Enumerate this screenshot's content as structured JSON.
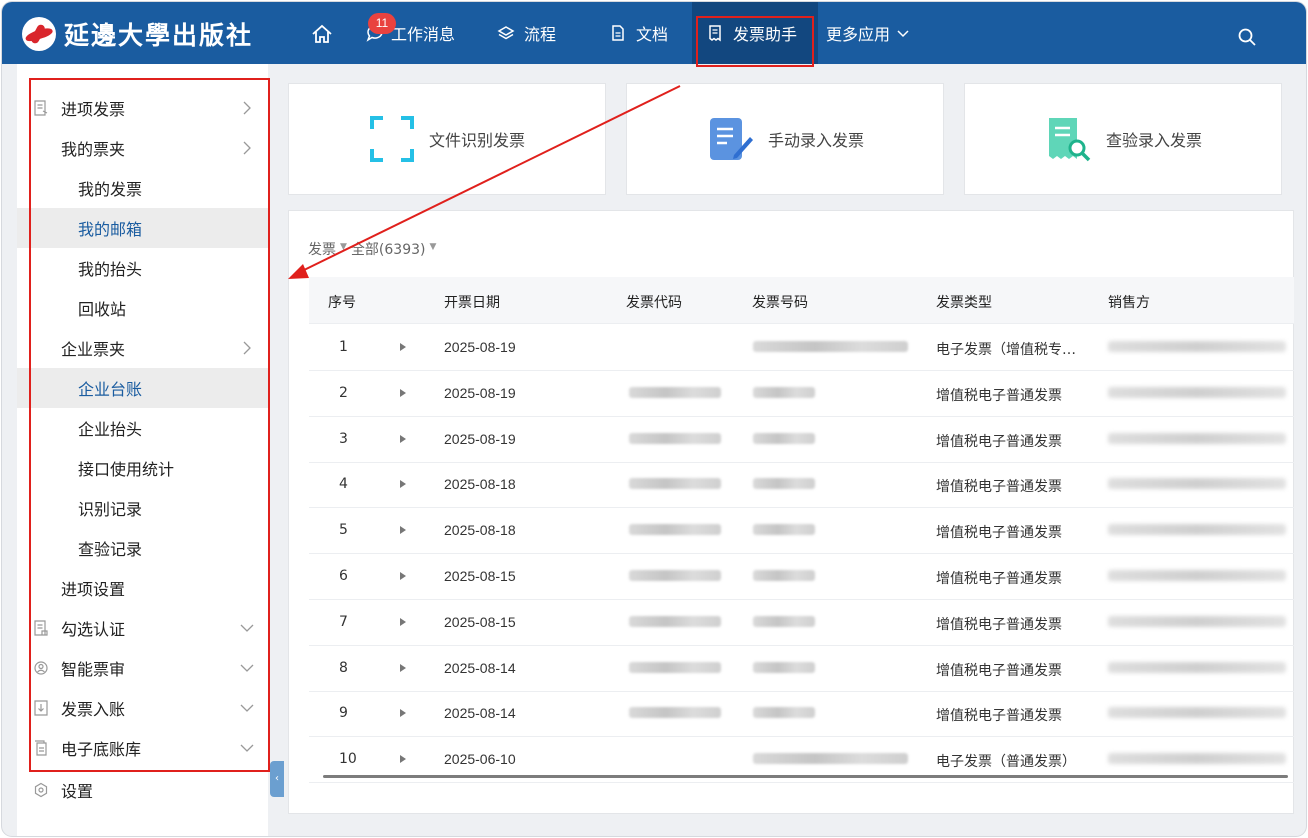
{
  "brand": {
    "name": "延邊大學出版社"
  },
  "nav": {
    "items": [
      {
        "label": "工作消息",
        "badge": "11"
      },
      {
        "label": "流程"
      },
      {
        "label": "文档"
      },
      {
        "label": "发票助手"
      },
      {
        "label": "更多应用"
      }
    ]
  },
  "sidebar": {
    "items": [
      {
        "label": "进项发票"
      },
      {
        "label": "我的票夹"
      },
      {
        "label": "我的发票"
      },
      {
        "label": "我的邮箱"
      },
      {
        "label": "我的抬头"
      },
      {
        "label": "回收站"
      },
      {
        "label": "企业票夹"
      },
      {
        "label": "企业台账"
      },
      {
        "label": "企业抬头"
      },
      {
        "label": "接口使用统计"
      },
      {
        "label": "识别记录"
      },
      {
        "label": "查验记录"
      },
      {
        "label": "进项设置"
      },
      {
        "label": "勾选认证"
      },
      {
        "label": "智能票审"
      },
      {
        "label": "发票入账"
      },
      {
        "label": "电子底账库"
      },
      {
        "label": "设置"
      }
    ],
    "collapse_glyph": "‹"
  },
  "cards": [
    {
      "label": "文件识别发票",
      "icon": "scan-frame-icon"
    },
    {
      "label": "手动录入发票",
      "icon": "document-edit-icon"
    },
    {
      "label": "查验录入发票",
      "icon": "receipt-search-icon"
    }
  ],
  "filter": {
    "type": "发票",
    "scope": "全部(6393)"
  },
  "table": {
    "headers": [
      "序号",
      "开票日期",
      "发票代码",
      "发票号码",
      "发票类型",
      "销售方"
    ],
    "rows": [
      {
        "no": "1",
        "date": "2025-08-19",
        "type": "电子发票（增值税专…"
      },
      {
        "no": "2",
        "date": "2025-08-19",
        "type": "增值税电子普通发票"
      },
      {
        "no": "3",
        "date": "2025-08-19",
        "type": "增值税电子普通发票"
      },
      {
        "no": "4",
        "date": "2025-08-18",
        "type": "增值税电子普通发票"
      },
      {
        "no": "5",
        "date": "2025-08-18",
        "type": "增值税电子普通发票"
      },
      {
        "no": "6",
        "date": "2025-08-15",
        "type": "增值税电子普通发票"
      },
      {
        "no": "7",
        "date": "2025-08-15",
        "type": "增值税电子普通发票"
      },
      {
        "no": "8",
        "date": "2025-08-14",
        "type": "增值税电子普通发票"
      },
      {
        "no": "9",
        "date": "2025-08-14",
        "type": "增值税电子普通发票"
      },
      {
        "no": "10",
        "date": "2025-06-10",
        "type": "电子发票（普通发票）"
      }
    ]
  },
  "colors": {
    "topbar": "#1a5ca0",
    "accent": "#1a5ca0",
    "highlight": "#e0201c",
    "badge": "#e9423f"
  }
}
